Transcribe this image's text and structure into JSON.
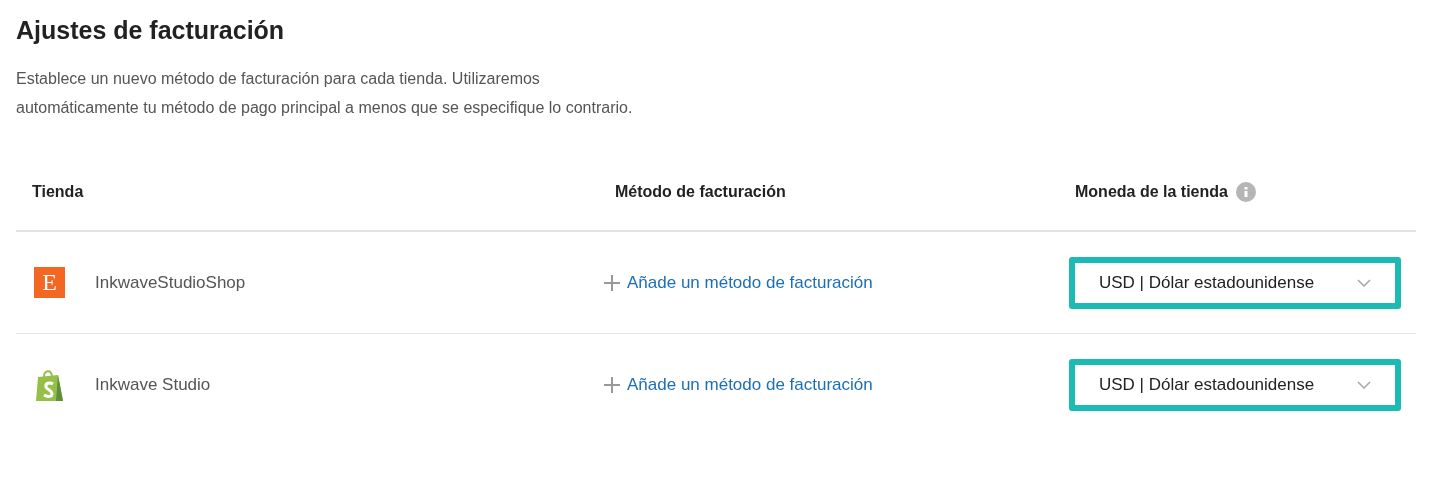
{
  "title": "Ajustes de facturación",
  "description": "Establece un nuevo método de facturación para cada tienda. Utilizaremos automáticamente tu método de pago principal a menos que se especifique lo contrario.",
  "table": {
    "columns": [
      {
        "label": "Tienda",
        "info": false
      },
      {
        "label": "Método de facturación",
        "info": false
      },
      {
        "label": "Moneda de la tienda",
        "info": true
      }
    ],
    "rows": [
      {
        "store": {
          "kind": "etsy",
          "logo_text": "E",
          "name": "InkwaveStudioShop"
        },
        "billing_link": "Añade un método de facturación",
        "currency": {
          "value": "USD | Dólar estadounidense",
          "highlighted": true
        }
      },
      {
        "store": {
          "kind": "shopify",
          "name": "Inkwave Studio"
        },
        "billing_link": "Añade un método de facturación",
        "currency": {
          "value": "USD | Dólar estadounidense",
          "highlighted": true
        }
      }
    ]
  }
}
